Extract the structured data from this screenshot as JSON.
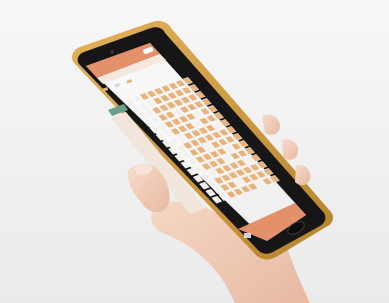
{
  "photo": {
    "subject": "hand-holding-smartphone",
    "background_color": "#f2f2f2",
    "phone_frame_color": "#d8a24a",
    "phone_body_color": "#141414",
    "screen_header_color": "#e4906a",
    "seat_available_color": "#e9b27b",
    "seat_taken_color": "#f3f1ee",
    "skin_color": "#f2d3c0"
  }
}
